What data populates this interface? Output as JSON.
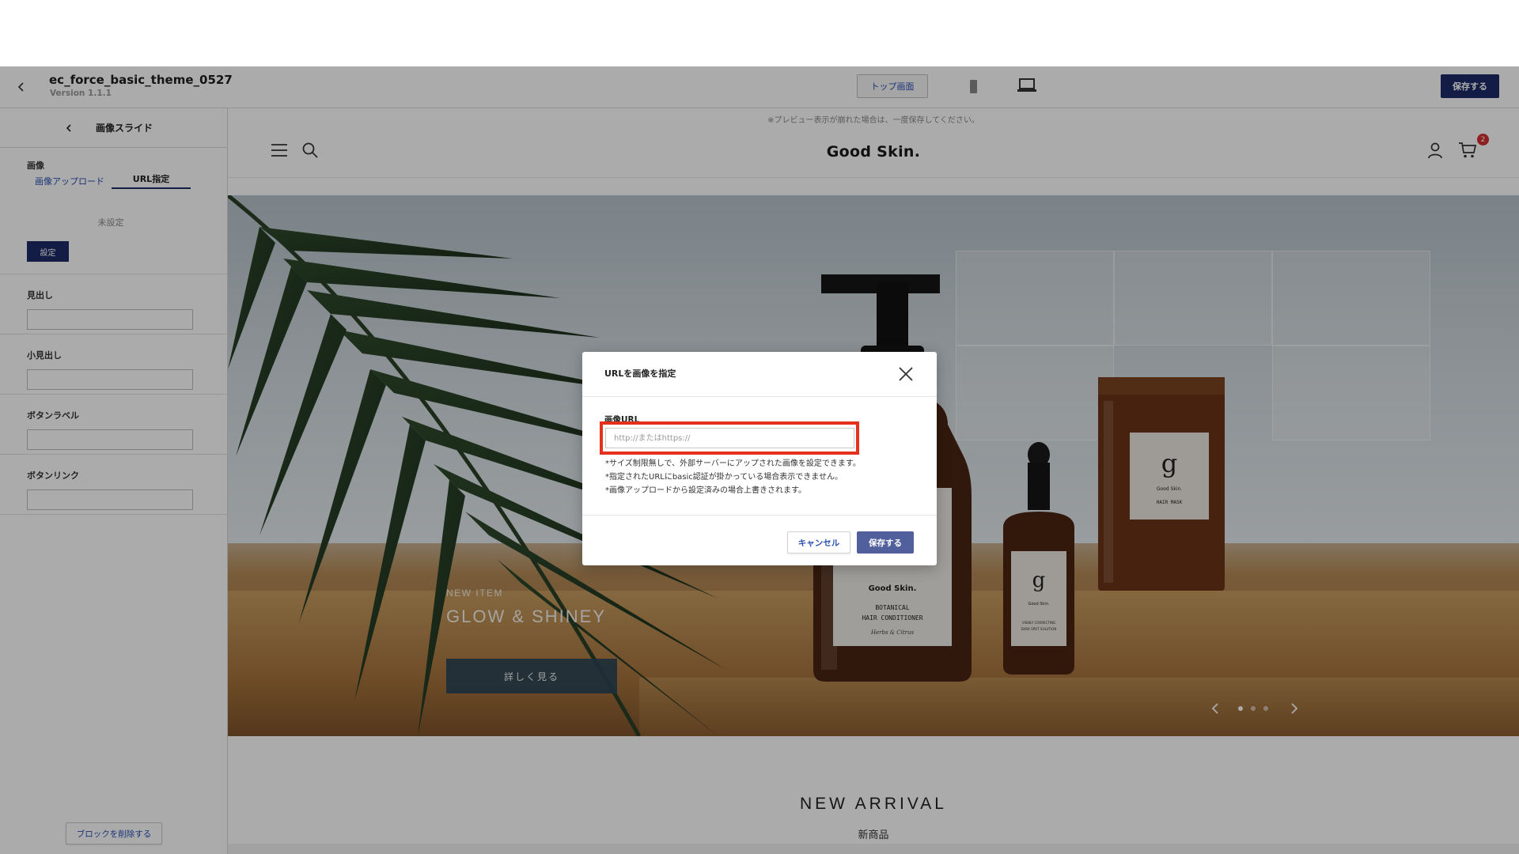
{
  "header": {
    "theme_name": "ec_force_basic_theme_0527",
    "version": "Version 1.1.1",
    "top_screen_label": "トップ画面",
    "save_label": "保存する"
  },
  "sidebar": {
    "title": "画像スライド",
    "image_label": "画像",
    "tabs": [
      {
        "label": "画像アップロード"
      },
      {
        "label": "URL指定"
      }
    ],
    "unset_text": "未設定",
    "set_button": "設定",
    "fields": [
      {
        "label": "見出し",
        "value": ""
      },
      {
        "label": "小見出し",
        "value": ""
      },
      {
        "label": "ボタンラベル",
        "value": ""
      },
      {
        "label": "ボタンリンク",
        "value": ""
      }
    ],
    "delete_button": "ブロックを削除する"
  },
  "preview": {
    "note": "※プレビュー表示が崩れた場合は、一度保存してください。",
    "logo": "Good Skin.",
    "cart_count": "2",
    "hero": {
      "eyebrow": "NEW ITEM",
      "title": "GLOW & SHINEY",
      "cta": "詳しく見る",
      "slide_count": 3,
      "active_slide": 1
    },
    "section_title": "NEW ARRIVAL",
    "section_subtitle": "新商品"
  },
  "product_labels": {
    "brand": "Good Skin.",
    "conditioner_line1": "BOTANICAL",
    "conditioner_line2": "HAIR CONDITIONER",
    "conditioner_line3": "Herbs & Citrus",
    "hair_mask": "HAIR MASK",
    "serum_line1": "VISIBLY CORRECTING",
    "serum_line2": "DARK SPOT SOLUTION"
  },
  "modal": {
    "title": "URLを画像を指定",
    "field_label": "画像URL",
    "placeholder": "http://またはhttps://",
    "value": "",
    "notes": [
      "*サイズ制限無しで、外部サーバーにアップされた画像を設定できます。",
      "*指定されたURLにbasic認証が掛かっている場合表示できません。",
      "*画像アップロードから設定済みの場合上書きされます。"
    ],
    "cancel_label": "キャンセル",
    "save_label": "保存する"
  },
  "colors": {
    "primary": "#1c2b66",
    "link": "#2b4fb3",
    "highlight": "#e5311c",
    "badge": "#d32f2f"
  }
}
